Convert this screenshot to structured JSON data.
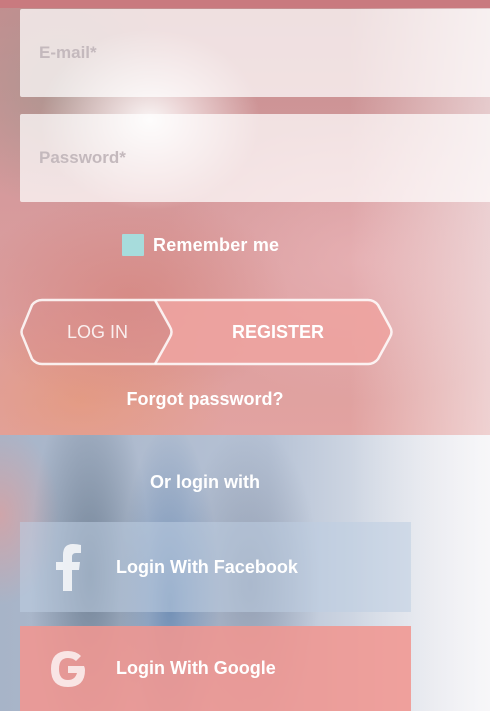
{
  "form": {
    "email_placeholder": "E-mail*",
    "password_placeholder": "Password*",
    "remember_label": "Remember me",
    "remember_checked": false
  },
  "toggle": {
    "login_label": "LOG IN",
    "register_label": "REGISTER",
    "active": "register"
  },
  "links": {
    "forgot_password": "Forgot password?"
  },
  "social": {
    "heading": "Or login with",
    "facebook_label": "Login With Facebook",
    "google_label": "Login With Google",
    "facebook_icon": "facebook-f-icon",
    "google_icon": "google-g-icon"
  },
  "colors": {
    "checkbox": "#a7dcdc",
    "register_fill": "#eda3a0",
    "google_button": "#f0968f",
    "text": "#ffffff"
  }
}
